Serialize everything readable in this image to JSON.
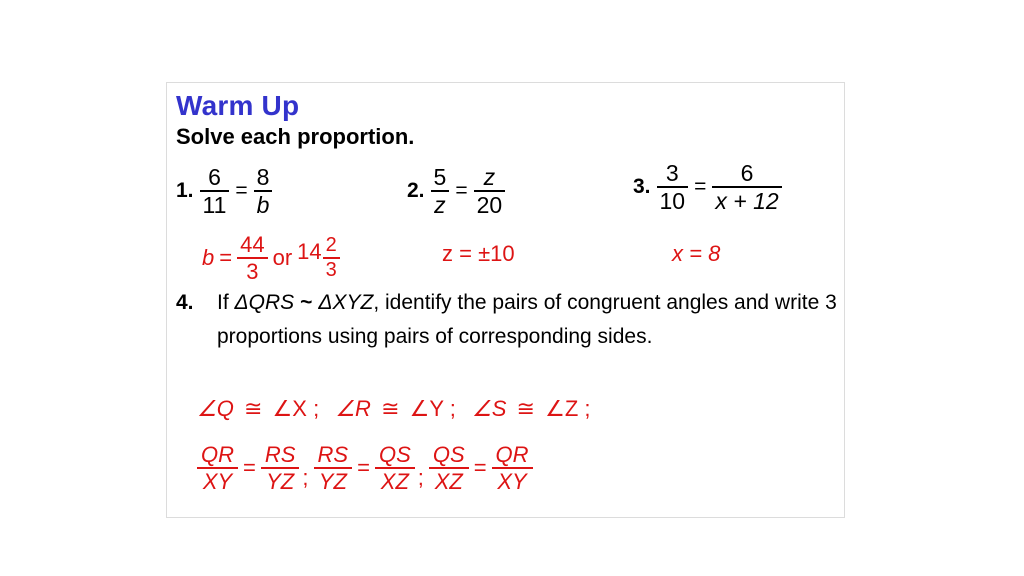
{
  "slide": {
    "background_color": "#ffffff",
    "card_border_color": "#dcdcdc",
    "accent_color": "#3333cc",
    "answer_color": "#dd1414",
    "text_color": "#000000"
  },
  "header": {
    "title": "Warm Up",
    "subtitle": "Solve each proportion."
  },
  "problems": [
    {
      "number": "1.",
      "left_numerator": "6",
      "left_denominator": "11",
      "equals": "=",
      "right_numerator": "8",
      "right_denominator": "b",
      "answer_variable": "b",
      "answer_equals": "=",
      "answer_numerator": "44",
      "answer_denominator": "3",
      "answer_connector": "or",
      "answer_whole": "14",
      "answer_mixed_numerator": "2",
      "answer_mixed_denominator": "3"
    },
    {
      "number": "2.",
      "left_numerator": "5",
      "left_denominator": "z",
      "equals": "=",
      "right_numerator": "z",
      "right_denominator": "20",
      "answer": "z = ±10"
    },
    {
      "number": "3.",
      "left_numerator": "3",
      "left_denominator": "10",
      "equals": "=",
      "right_numerator": "6",
      "right_denominator": "x + 12",
      "answer": "x = 8"
    }
  ],
  "problem4": {
    "number": "4.",
    "text": "If ΔQRS ~ ΔXYZ, identify the pairs of congruent angles and write 3 proportions using pairs of corresponding sides.",
    "text_lead": "If ",
    "triangle1": "ΔQRS",
    "similar_symbol": "~",
    "triangle2": "ΔXYZ",
    "text_rest": ", identify the pairs of congruent angles and write 3 proportions using pairs of corresponding sides.",
    "angle_answer": "∠Q ≅ ∠X;  ∠R ≅ ∠Y;  ∠S ≅ ∠Z;",
    "angle_pairs": [
      {
        "left": "∠Q",
        "symbol": "≅",
        "right": "∠X",
        "terminator": ";"
      },
      {
        "left": "∠R",
        "symbol": "≅",
        "right": "∠Y",
        "terminator": ";"
      },
      {
        "left": "∠S",
        "symbol": "≅",
        "right": "∠Z",
        "terminator": ";"
      }
    ],
    "proportions": [
      {
        "left_numerator": "QR",
        "left_denominator": "XY",
        "equals": "=",
        "right_numerator": "RS",
        "right_denominator": "YZ",
        "separator": ";"
      },
      {
        "left_numerator": "RS",
        "left_denominator": "YZ",
        "equals": "=",
        "right_numerator": "QS",
        "right_denominator": "XZ",
        "separator": ";"
      },
      {
        "left_numerator": "QS",
        "left_denominator": "XZ",
        "equals": "=",
        "right_numerator": "QR",
        "right_denominator": "XY",
        "separator": ""
      }
    ]
  }
}
